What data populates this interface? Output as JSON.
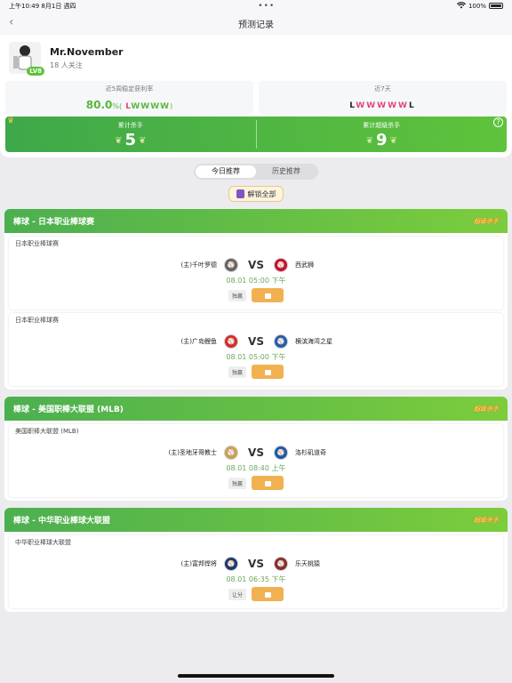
{
  "status": {
    "time": "上午10:49",
    "date": "8月1日 週四",
    "dots": "•••",
    "battery": "100%"
  },
  "nav": {
    "back": "‹",
    "title": "预测记录"
  },
  "user": {
    "name": "Mr.November",
    "fans": "18 人关注",
    "level": "LV8"
  },
  "stats": {
    "rate_label": "近5周稳定获利率",
    "rate_value": "80.0",
    "rate_unit": "%(",
    "rate_seq": [
      "L",
      "W",
      "W",
      "W",
      "W"
    ],
    "rate_close": ")",
    "seven_label": "近7天",
    "seven_seq": [
      "L",
      "W",
      "W",
      "W",
      "W",
      "W",
      "L"
    ]
  },
  "killers": {
    "killer_label": "累计杀手",
    "killer_value": "5",
    "super_label": "累计超级杀手",
    "super_value": "9",
    "help": "?"
  },
  "tabs": [
    "今日推荐",
    "历史推荐"
  ],
  "unlock_label": "解锁全部",
  "leagues": [
    {
      "title": "棒球 - 日本职业棒球赛",
      "badge": "超级杀手",
      "matches": [
        {
          "league": "日本职业棒球赛",
          "home": "(主)千叶罗德",
          "away": "西武狮",
          "time": "08.01 05:00 下午",
          "type": "独赢",
          "home_color": "#666",
          "away_color": "#c8102e"
        },
        {
          "league": "日本职业棒球赛",
          "home": "(主)广岛鲤鱼",
          "away": "横滨海湾之星",
          "time": "08.01 05:00 下午",
          "type": "独赢",
          "home_color": "#d62b2b",
          "away_color": "#1f5fb0"
        }
      ]
    },
    {
      "title": "棒球 - 美国职棒大联盟 (MLB)",
      "badge": "超级杀手",
      "matches": [
        {
          "league": "美国职棒大联盟 (MLB)",
          "home": "(主)圣地牙哥教士",
          "away": "洛杉矶道奇",
          "time": "08.01 08:40 上午",
          "type": "独赢",
          "home_color": "#c8a050",
          "away_color": "#1e5aa8"
        }
      ]
    },
    {
      "title": "棒球 - 中华职业棒球大联盟",
      "badge": "超级杀手",
      "matches": [
        {
          "league": "中华职业棒球大联盟",
          "home": "(主)富邦悍将",
          "away": "乐天桃猿",
          "time": "08.01 06:35 下午",
          "type": "让分",
          "home_color": "#1b3a6b",
          "away_color": "#8a2c2c"
        }
      ]
    }
  ]
}
